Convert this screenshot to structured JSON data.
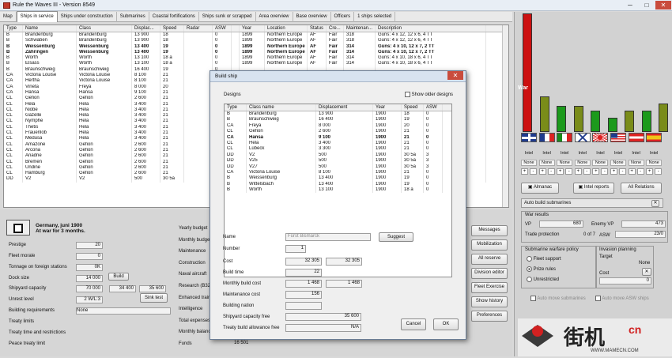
{
  "window": {
    "title": "Rule the Waves III - Version 8549",
    "min": "─",
    "max": "□",
    "close": "✕"
  },
  "tabs": [
    "Map",
    "Ships in service",
    "Ships under construction",
    "Submarines",
    "Coastal fortifications",
    "Ships sunk or scrapped",
    "Area overview",
    "Base overview",
    "Officers",
    "1 ships selected"
  ],
  "fleet": {
    "columns": [
      "Type",
      "Name",
      "Class",
      "Displac...",
      "Speed",
      "Radar",
      "ASW",
      "",
      "Year",
      "Location",
      "Status",
      "Cre...",
      "Maintenan...",
      "Description"
    ],
    "rows": [
      [
        "B",
        "Brandenburg",
        "Brandenburg",
        "13 900",
        "18",
        "",
        "0",
        "",
        "1899",
        "Northern Europe",
        "AF",
        "Fair",
        "318",
        "Guns: 4 x 12, 12 x 6, 4 TT"
      ],
      [
        "B",
        "Schwaben",
        "Brandenburg",
        "13 900",
        "18",
        "",
        "0",
        "",
        "1899",
        "Northern Europe",
        "AF",
        "Fair",
        "318",
        "Guns: 4 x 12, 12 x 6, 4 TT"
      ],
      [
        "B",
        "Weissenburg",
        "Weissenburg",
        "13 400",
        "19",
        "",
        "0",
        "",
        "1899",
        "Northern Europe",
        "AF",
        "Fair",
        "314",
        "Guns: 4 x 10, 12 x 7, 2 TT"
      ],
      [
        "B",
        "Zähringen",
        "Weissenburg",
        "13 400",
        "19",
        "",
        "0",
        "",
        "1899",
        "Northern Europe",
        "AF",
        "Fair",
        "314",
        "Guns: 4 x 10, 12 x 7, 2 TT"
      ],
      [
        "B",
        "Wörth",
        "Wörth",
        "13 100",
        "18 a",
        "",
        "0",
        "",
        "1899",
        "Northern Europe",
        "AF",
        "Fair",
        "314",
        "Guns: 4 x 10, 18 x 6, 4 TT"
      ],
      [
        "B",
        "Elsass",
        "Wörth",
        "13 100",
        "18 a",
        "",
        "0",
        "",
        "1899",
        "Northern Europe",
        "AF",
        "Fair",
        "314",
        "Guns: 4 x 10, 18 x 6, 4 TT"
      ],
      [
        "B",
        "Braunschweig",
        "Braunschweig",
        "16 400",
        "19",
        "",
        "0",
        "",
        "",
        "",
        "",
        "",
        "",
        ""
      ],
      [
        "CA",
        "Victoria Louise",
        "Victoria Louise",
        "8 100",
        "21",
        "",
        "0",
        "",
        "",
        "",
        "",
        "",
        "",
        ""
      ],
      [
        "CA",
        "Hertha",
        "Victoria Louise",
        "8 100",
        "21",
        "",
        "0",
        "",
        "",
        "",
        "",
        "",
        "",
        ""
      ],
      [
        "CA",
        "Vineta",
        "Freya",
        "8 000",
        "20",
        "",
        "0",
        "",
        "",
        "",
        "",
        "",
        "",
        ""
      ],
      [
        "CA",
        "Hansa",
        "Hansa",
        "9 100",
        "21",
        "",
        "0",
        "",
        "",
        "",
        "",
        "",
        "",
        ""
      ],
      [
        "CL",
        "Gefion",
        "Gefion",
        "2 600",
        "21",
        "",
        "0",
        "",
        "",
        "",
        "",
        "",
        "",
        ""
      ],
      [
        "CL",
        "Hela",
        "Hela",
        "3 400",
        "21",
        "",
        "0",
        "",
        "",
        "",
        "",
        "",
        "",
        ""
      ],
      [
        "CL",
        "Niobe",
        "Hela",
        "3 400",
        "21",
        "",
        "0",
        "",
        "",
        "",
        "",
        "",
        "",
        ""
      ],
      [
        "CL",
        "Gazelle",
        "Hela",
        "3 400",
        "21",
        "",
        "0",
        "",
        "",
        "",
        "",
        "",
        "",
        ""
      ],
      [
        "CL",
        "Nymphe",
        "Hela",
        "3 400",
        "21",
        "",
        "0",
        "",
        "",
        "",
        "",
        "",
        "",
        ""
      ],
      [
        "CL",
        "Thetis",
        "Hela",
        "3 400",
        "21",
        "",
        "0",
        "",
        "",
        "",
        "",
        "",
        "",
        ""
      ],
      [
        "CL",
        "Frauenlob",
        "Hela",
        "3 400",
        "21",
        "",
        "0",
        "",
        "",
        "",
        "",
        "",
        "",
        ""
      ],
      [
        "CL",
        "Medusa",
        "Hela",
        "3 400",
        "21",
        "",
        "0",
        "",
        "",
        "",
        "",
        "",
        "",
        ""
      ],
      [
        "CL",
        "Amazone",
        "Gefion",
        "2 600",
        "21",
        "",
        "0",
        "",
        "",
        "",
        "",
        "",
        "",
        ""
      ],
      [
        "CL",
        "Arcona",
        "Gefion",
        "2 600",
        "21",
        "",
        "0",
        "",
        "",
        "",
        "",
        "",
        "",
        ""
      ],
      [
        "CL",
        "Ariadne",
        "Gefion",
        "2 600",
        "21",
        "",
        "0",
        "",
        "",
        "",
        "",
        "",
        "",
        ""
      ],
      [
        "CL",
        "Bremen",
        "Gefion",
        "2 600",
        "21",
        "",
        "0",
        "",
        "",
        "",
        "",
        "",
        "",
        ""
      ],
      [
        "CL",
        "Undine",
        "Gefion",
        "2 600",
        "21",
        "",
        "0",
        "",
        "",
        "",
        "",
        "",
        "",
        ""
      ],
      [
        "CL",
        "Hamburg",
        "Gefion",
        "2 600",
        "21",
        "",
        "0",
        "",
        "",
        "",
        "",
        "",
        "",
        ""
      ],
      [
        "DD",
        "V2",
        "V2",
        "500",
        "30 5a",
        "",
        "3",
        "",
        "",
        "",
        "",
        "",
        "",
        ""
      ]
    ],
    "bold_rows": [
      2,
      3
    ]
  },
  "status": {
    "nation_line1": "Germany, juni 1900",
    "nation_line2": "At war for 3 months."
  },
  "left_fields": [
    {
      "label": "Prestige",
      "value": "20"
    },
    {
      "label": "Fleet morale",
      "value": "0"
    },
    {
      "label": "Tonnage on foreign stations",
      "value": "0K"
    },
    {
      "label": "Dock size",
      "value": "14 000"
    },
    {
      "label": "Shipyard capacity",
      "value": "70 000",
      "v2": "34 400",
      "v3": "35 600"
    },
    {
      "label": "Unrest level",
      "value": "2 W/L:3"
    },
    {
      "label": "Building requirements",
      "value": "None"
    },
    {
      "label": "Treaty limits",
      "value": ""
    },
    {
      "label": "Treaty time and restrictions",
      "value": ""
    },
    {
      "label": "Peace treaty limit",
      "value": ""
    }
  ],
  "left_buttons": {
    "build": "Build",
    "sink_test": "Sink test"
  },
  "budget_labels": [
    "Yearly budget",
    "Monthly budget",
    "Maintenance",
    "Construction",
    "Naval aircraft",
    "Research (B32)",
    "Enhanced training",
    "Intelligence",
    "Total expenses",
    "Monthly balance",
    "Funds"
  ],
  "funds_value": "16 501",
  "side_buttons": [
    "Messages",
    "Mobilization",
    "All reserve",
    "Division editor",
    "Fleet Exercise",
    "Show history",
    "Preferences"
  ],
  "intel": {
    "bars": [
      {
        "value": 100,
        "color": "#cc1111"
      },
      {
        "value": 30,
        "color": "#7a8c1a"
      },
      {
        "value": 22,
        "color": "#1c9a1c"
      },
      {
        "value": 22,
        "color": "#7a8c1a"
      },
      {
        "value": 18,
        "color": "#1c9a1c"
      },
      {
        "value": 12,
        "color": "#1c9a1c"
      },
      {
        "value": 18,
        "color": "#7a8c1a"
      },
      {
        "value": 18,
        "color": "#1c9a1c"
      },
      {
        "value": 24,
        "color": "#7a8c1a"
      }
    ],
    "war_label": "War",
    "flags": [
      "uk",
      "fr",
      "it",
      "ru",
      "jp",
      "us",
      "at",
      "es"
    ],
    "intel_label": "Intel",
    "none_label": "None",
    "buttons": {
      "almanac": "Almanac",
      "intel_reports": "Intel reports",
      "all_relations": "All Relations"
    }
  },
  "auto_build": {
    "label": "Auto build submarines"
  },
  "war_results": {
    "title": "War results",
    "vp_label": "VP",
    "vp": "680",
    "enemy_vp_label": "Enemy VP",
    "enemy_vp": "473",
    "trade_label": "Trade protection",
    "trade": "0 of 7",
    "asw_label": "ASW",
    "asw": "23/0"
  },
  "sub_policy": {
    "title": "Submarine warfare policy",
    "options": [
      "Fleet support",
      "Prize rules",
      "Unrestricted"
    ],
    "selected": 1
  },
  "invasion": {
    "title": "Invasion planning",
    "target_label": "Target",
    "target": "None",
    "cost_label": "Cost",
    "cost": "0"
  },
  "auto_move": {
    "label1": "Auto move submarines",
    "label2": "Auto move ASW ships"
  },
  "watermark": {
    "text": "街机",
    "suffix": "cn",
    "url": "WWW.MAMECN.COM"
  },
  "dialog": {
    "title": "Build ship",
    "designs_label": "Designs",
    "show_older": "Show older designs",
    "columns": [
      "Type",
      "Class name",
      "Displacement",
      "Year",
      "Speed",
      "ASW"
    ],
    "rows": [
      [
        "B",
        "Brandenburg",
        "13 900",
        "1900",
        "18",
        "0"
      ],
      [
        "B",
        "Braunschweig",
        "16 400",
        "1900",
        "19",
        "0"
      ],
      [
        "CA",
        "Freya",
        "8 000",
        "1900",
        "20",
        "0"
      ],
      [
        "CL",
        "Gefion",
        "2 600",
        "1900",
        "21",
        "0"
      ],
      [
        "CA",
        "Hansa",
        "9 100",
        "1900",
        "21",
        "0"
      ],
      [
        "CL",
        "Hela",
        "3 400",
        "1900",
        "21",
        "0"
      ],
      [
        "CL",
        "Lübeck",
        "3 300",
        "1900",
        "21",
        "0"
      ],
      [
        "DD",
        "V2",
        "500",
        "1900",
        "30 5a",
        "3"
      ],
      [
        "DD",
        "V25",
        "500",
        "1900",
        "30 5a",
        "3"
      ],
      [
        "DD",
        "V27",
        "500",
        "1900",
        "30 5a",
        "3"
      ],
      [
        "CA",
        "Victoria Louise",
        "8 100",
        "1900",
        "21",
        "0"
      ],
      [
        "B",
        "Weissenburg",
        "13 400",
        "1900",
        "19",
        "0"
      ],
      [
        "B",
        "Wittelsbach",
        "13 400",
        "1900",
        "19",
        "0"
      ],
      [
        "B",
        "Wörth",
        "13 100",
        "1900",
        "18 a",
        "0"
      ]
    ],
    "selected_row": 4,
    "name_label": "Name",
    "name_value": "Fürst Bismarck",
    "suggest": "Suggest",
    "number_label": "Number",
    "number_value": "1",
    "cost_label": "Cost",
    "cost1": "32 305",
    "cost2": "32 305",
    "build_time_label": "Build time",
    "build_time": "22",
    "monthly_label": "Monthly build cost",
    "monthly1": "1 468",
    "monthly2": "1 468",
    "maint_label": "Maintenance cost",
    "maint": "156",
    "nation_label": "Building nation",
    "nation": "",
    "capacity_label": "Shipyard capacity free",
    "capacity": "35 600",
    "treaty_label": "Treaty build allowance free",
    "treaty": "N/A",
    "cancel": "Cancel",
    "ok": "OK"
  }
}
